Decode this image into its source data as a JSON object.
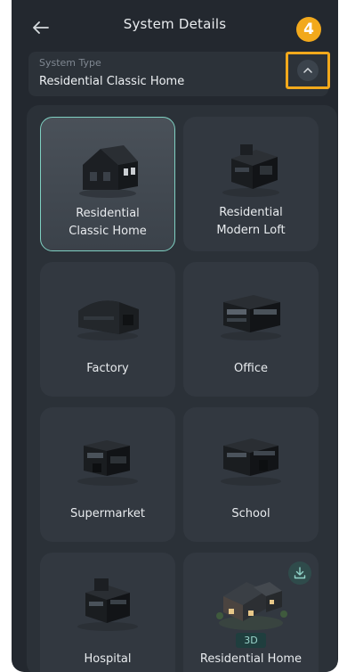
{
  "header": {
    "title": "System Details",
    "step_badge": "4"
  },
  "system_type": {
    "label": "System Type",
    "value": "Residential Classic Home"
  },
  "cards": [
    {
      "label_line1": "Residential",
      "label_line2": "Classic Home",
      "selected": true
    },
    {
      "label_line1": "Residential",
      "label_line2": "Modern Loft"
    },
    {
      "label": "Factory"
    },
    {
      "label": "Office"
    },
    {
      "label": "Supermarket"
    },
    {
      "label": "School"
    },
    {
      "label": "Hospital"
    },
    {
      "label": "Residential Home",
      "badge": "3D",
      "downloadable": true
    }
  ],
  "colors": {
    "accent": "#f2a91c",
    "selected_border": "#7fd0c2",
    "background": "#23282f"
  },
  "icons": {
    "back": "back-arrow-icon",
    "chevron": "chevron-up-icon",
    "download": "download-icon"
  }
}
